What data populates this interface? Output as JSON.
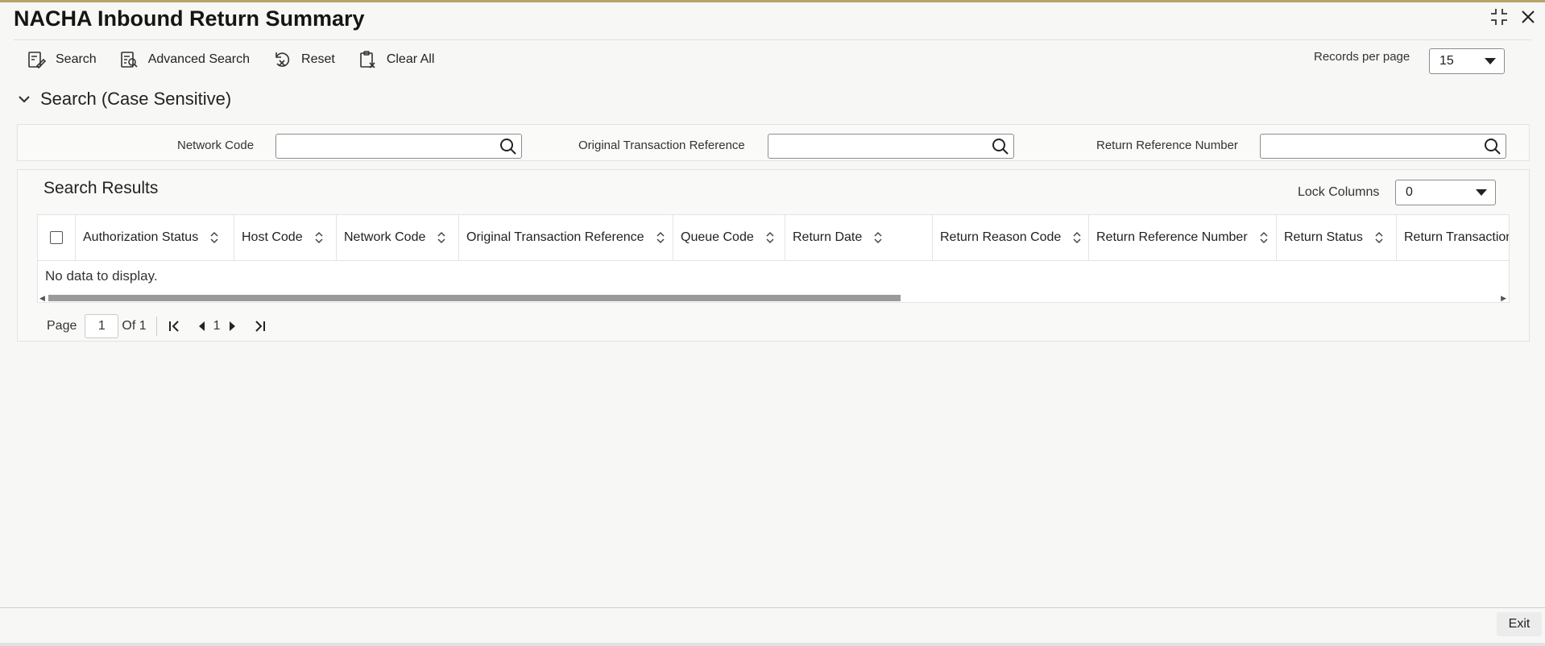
{
  "window": {
    "title": "NACHA Inbound Return Summary"
  },
  "toolbar": {
    "search": "Search",
    "advanced_search": "Advanced Search",
    "reset": "Reset",
    "clear_all": "Clear All"
  },
  "records_per_page": {
    "label": "Records per page",
    "value": "15"
  },
  "search_section": {
    "title": "Search (Case Sensitive)",
    "fields": [
      {
        "label": "Network Code",
        "value": ""
      },
      {
        "label": "Original Transaction Reference",
        "value": ""
      },
      {
        "label": "Return Reference Number",
        "value": ""
      }
    ]
  },
  "results": {
    "title": "Search Results",
    "lock_columns_label": "Lock Columns",
    "lock_columns_value": "0",
    "columns": [
      "Authorization Status",
      "Host Code",
      "Network Code",
      "Original Transaction Reference",
      "Queue Code",
      "Return Date",
      "Return Reason Code",
      "Return Reference Number",
      "Return Status",
      "Return Transaction"
    ],
    "empty_text": "No data to display."
  },
  "pagination": {
    "page_label": "Page",
    "current_page": "1",
    "of_label": "Of 1",
    "page_number": "1"
  },
  "footer": {
    "exit": "Exit"
  },
  "icons": {
    "minimize": "minimize-icon",
    "close": "close-icon"
  }
}
